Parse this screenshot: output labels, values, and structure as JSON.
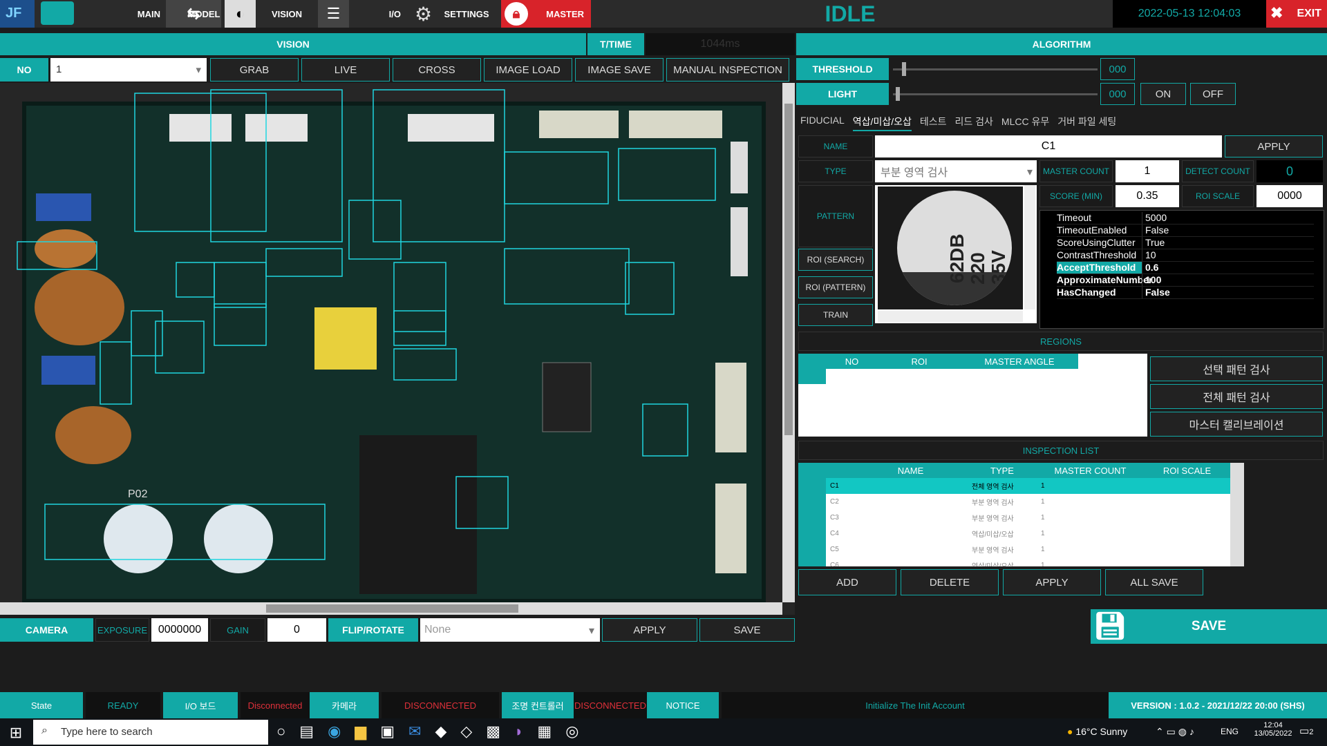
{
  "top": {
    "main": "MAIN",
    "model": "MODEL",
    "vision": "VISION",
    "io": "I/O",
    "settings": "SETTINGS",
    "master": "MASTER",
    "state": "IDLE",
    "datetime": "2022-05-13 12:04:03",
    "exit": "EXIT"
  },
  "vision": {
    "header": "VISION",
    "ttime_label": "T/TIME",
    "ttime_value": "1044ms",
    "no_label": "NO",
    "no_value": "1",
    "buttons": [
      "GRAB",
      "LIVE",
      "CROSS",
      "IMAGE LOAD",
      "IMAGE SAVE",
      "MANUAL INSPECTION"
    ]
  },
  "camera": {
    "label": "CAMERA",
    "exposure_label": "EXPOSURE",
    "exposure_value": "0000000",
    "gain_label": "GAIN",
    "gain_value": "0",
    "flip_label": "FLIP/ROTATE",
    "flip_value": "None",
    "apply": "APPLY",
    "save": "SAVE"
  },
  "algorithm": {
    "header": "ALGORITHM",
    "threshold_label": "THRESHOLD",
    "threshold_value": "000",
    "light_label": "LIGHT",
    "light_value": "000",
    "on": "ON",
    "off": "OFF",
    "threshold_level": 0.05,
    "light_level": 0.02,
    "tabs": [
      "FIDUCIAL",
      "역삽/미삽/오삽",
      "테스트",
      "리드 검사",
      "MLCC 유무",
      "거버 파일 세팅"
    ],
    "name_label": "NAME",
    "name_value": "C1",
    "apply": "APPLY",
    "type_label": "TYPE",
    "type_value": "부분 영역 검사",
    "master_count_label": "MASTER COUNT",
    "master_count_value": "1",
    "detect_count_label": "DETECT COUNT",
    "detect_count_value": "0",
    "score_label": "SCORE (MIN)",
    "score_value": "0.35",
    "roi_scale_label": "ROI SCALE",
    "roi_scale_value": "0000",
    "pattern": "PATTERN",
    "roi_search": "ROI (SEARCH)",
    "roi_pattern": "ROI (PATTERN)",
    "train": "TRAIN",
    "capacitor_text": [
      "62DB",
      "220",
      "35V"
    ],
    "props": [
      {
        "k": "Timeout",
        "v": "5000"
      },
      {
        "k": "TimeoutEnabled",
        "v": "False"
      },
      {
        "k": "ScoreUsingClutter",
        "v": "True"
      },
      {
        "k": "ContrastThreshold",
        "v": "10"
      },
      {
        "k": "AcceptThreshold",
        "v": "0.6"
      },
      {
        "k": "ApproximateNumber",
        "v": "100"
      },
      {
        "k": "HasChanged",
        "v": "False"
      }
    ],
    "regions_title": "REGIONS",
    "regions_cols": [
      "NO",
      "ROI",
      "MASTER ANGLE"
    ],
    "region_buttons": [
      "선택 패턴 검사",
      "전체 패턴 검사",
      "마스터 캘리브레이션"
    ],
    "inspection_title": "INSPECTION LIST",
    "inspection_cols": [
      "NAME",
      "TYPE",
      "MASTER COUNT",
      "ROI SCALE"
    ],
    "inspection_rows": [
      {
        "name": "C1",
        "type": "전체 영역 검사",
        "count": "1"
      },
      {
        "name": "C2",
        "type": "부분 영역 검사",
        "count": "1"
      },
      {
        "name": "C3",
        "type": "부분 영역 검사",
        "count": "1"
      },
      {
        "name": "C4",
        "type": "역삽/미삽/오삽",
        "count": "1"
      },
      {
        "name": "C5",
        "type": "부분 영역 검사",
        "count": "1"
      },
      {
        "name": "C6",
        "type": "역삽/미삽/오삽",
        "count": "1"
      }
    ],
    "list_buttons": [
      "ADD",
      "DELETE",
      "APPLY",
      "ALL SAVE"
    ],
    "save": "SAVE"
  },
  "status": {
    "state_label": "State",
    "state_value": "READY",
    "io_label": "I/O 보드",
    "io_value": "Disconnected",
    "cam_label": "카메라",
    "cam_value": "DISCONNECTED",
    "light_label": "조명 컨트롤러",
    "light_value": "DISCONNECTED",
    "notice_label": "NOTICE",
    "notice_value": "Initialize The Init Account",
    "version": "VERSION : 1.0.2 - 2021/12/22 20:00 (SHS)"
  },
  "taskbar": {
    "search": "Type here to search",
    "weather": "16°C  Sunny",
    "lang": "ENG",
    "time": "12:04",
    "date": "13/05/2022",
    "notif": "2"
  },
  "pcb": {
    "labels": [
      "P02"
    ]
  }
}
